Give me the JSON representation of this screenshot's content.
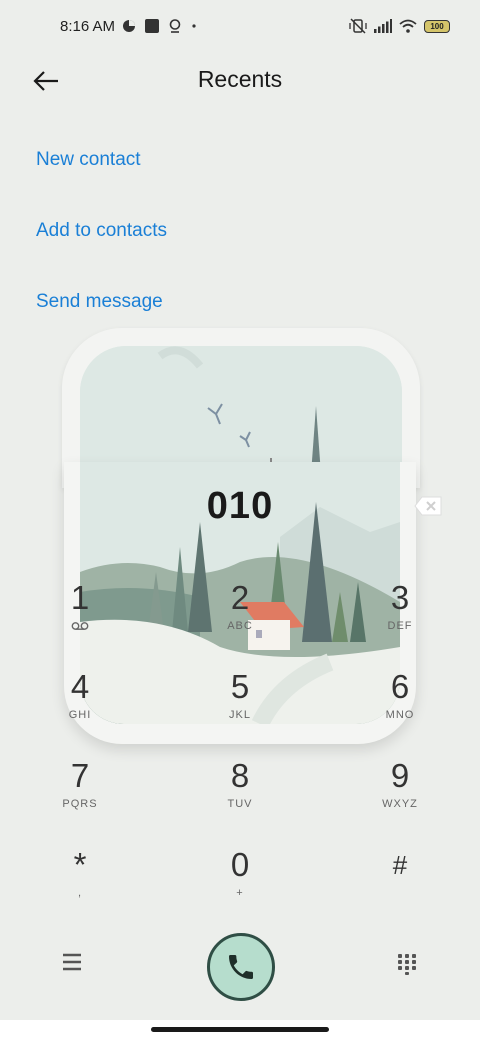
{
  "status_bar": {
    "time": "8:16 AM",
    "battery": "100",
    "icons_left": [
      "data-saver-icon",
      "square-app-icon",
      "location-icon",
      "dot-icon"
    ],
    "icons_right": [
      "vibrate-off-icon",
      "signal-icon",
      "wifi-icon",
      "battery-icon"
    ]
  },
  "header": {
    "title": "Recents",
    "back_icon": "arrow-left-icon"
  },
  "actions": {
    "new_contact": "New contact",
    "add_to_contacts": "Add to contacts",
    "send_message": "Send message"
  },
  "dialer": {
    "number": "010",
    "keys": [
      {
        "digit": "1",
        "letters": ""
      },
      {
        "digit": "2",
        "letters": "ABC"
      },
      {
        "digit": "3",
        "letters": "DEF"
      },
      {
        "digit": "4",
        "letters": "GHI"
      },
      {
        "digit": "5",
        "letters": "JKL"
      },
      {
        "digit": "6",
        "letters": "MNO"
      },
      {
        "digit": "7",
        "letters": "PQRS"
      },
      {
        "digit": "8",
        "letters": "TUV"
      },
      {
        "digit": "9",
        "letters": "WXYZ"
      },
      {
        "digit": "*",
        "letters": ","
      },
      {
        "digit": "0",
        "letters": "+"
      },
      {
        "digit": "#",
        "letters": ""
      }
    ]
  },
  "colors": {
    "accent": "#1a7fd6",
    "background": "#eceeeb",
    "call_button": "#b6ddcd"
  }
}
